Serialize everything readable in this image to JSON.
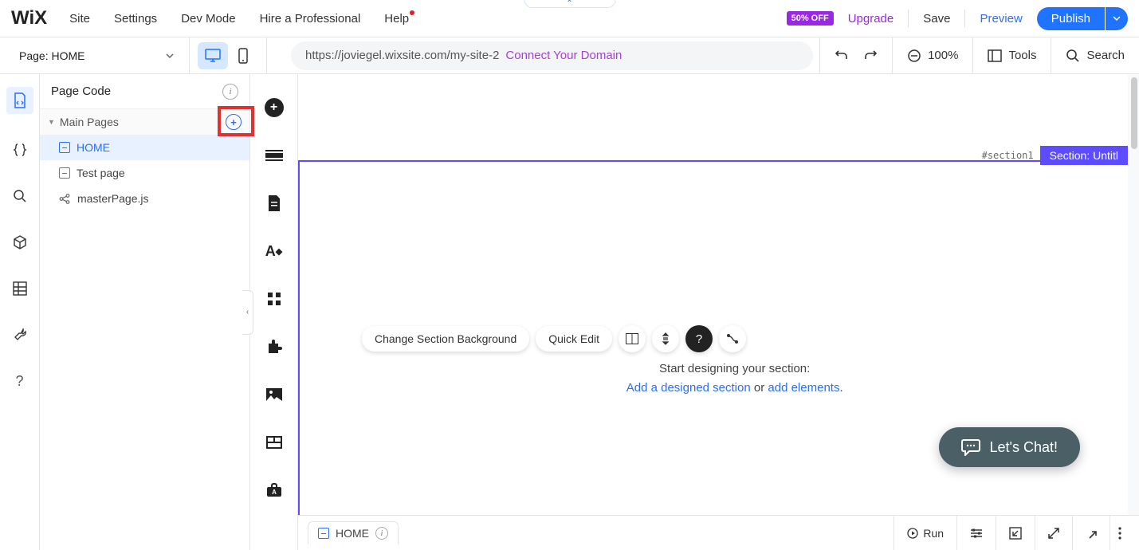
{
  "logo": "WiX",
  "menu": {
    "site": "Site",
    "settings": "Settings",
    "devmode": "Dev Mode",
    "hire": "Hire a Professional",
    "help": "Help"
  },
  "top_tab_caret": "⌃",
  "top": {
    "badge": "50% OFF",
    "upgrade": "Upgrade",
    "save": "Save",
    "preview": "Preview",
    "publish": "Publish"
  },
  "page_combo": {
    "label": "Page: HOME"
  },
  "url": {
    "value": "https://joviegel.wixsite.com/my-site-2",
    "connect": "Connect Your Domain"
  },
  "zoom": "100%",
  "tools": "Tools",
  "search": "Search",
  "side": {
    "header": "Page Code",
    "group": "Main Pages",
    "items": {
      "home": "HOME",
      "test": "Test page",
      "master": "masterPage.js"
    }
  },
  "canvas": {
    "section_tag": "#section1",
    "section_title": "Section: Untitl",
    "btn_bg": "Change Section Background",
    "btn_quick": "Quick Edit",
    "helper_line1": "Start designing your section:",
    "helper_link1": "Add a designed section",
    "helper_or": " or ",
    "helper_link2": "add elements",
    "helper_dot": "."
  },
  "chat": "Let's Chat!",
  "bottom": {
    "tab": "HOME",
    "run": "Run"
  }
}
